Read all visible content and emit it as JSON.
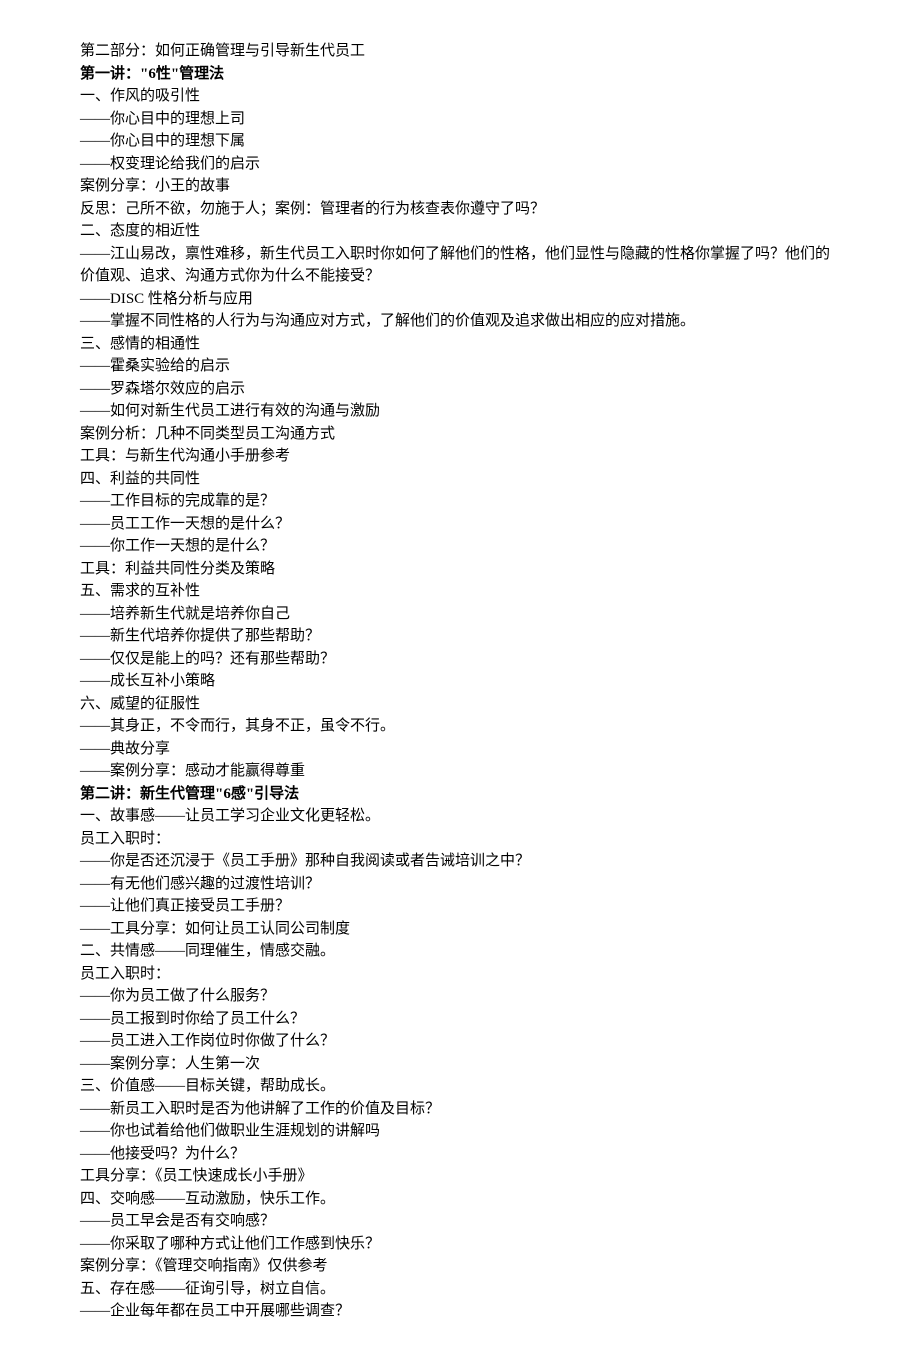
{
  "lines": [
    {
      "text": "第二部分：如何正确管理与引导新生代员工",
      "bold": false
    },
    {
      "text": "第一讲：\"6性\"管理法",
      "bold": true
    },
    {
      "text": "一、作风的吸引性",
      "bold": false
    },
    {
      "text": "——你心目中的理想上司",
      "bold": false
    },
    {
      "text": "——你心目中的理想下属",
      "bold": false
    },
    {
      "text": "——权变理论给我们的启示",
      "bold": false
    },
    {
      "text": "案例分享：小王的故事",
      "bold": false
    },
    {
      "text": "反思：己所不欲，勿施于人；案例：管理者的行为核查表你遵守了吗？",
      "bold": false
    },
    {
      "text": "二、态度的相近性",
      "bold": false
    },
    {
      "text": "——江山易改，禀性难移，新生代员工入职时你如何了解他们的性格，他们显性与隐藏的性格你掌握了吗？他们的价值观、追求、沟通方式你为什么不能接受？",
      "bold": false
    },
    {
      "text": "——DISC 性格分析与应用",
      "bold": false
    },
    {
      "text": "——掌握不同性格的人行为与沟通应对方式，了解他们的价值观及追求做出相应的应对措施。",
      "bold": false
    },
    {
      "text": "三、感情的相通性",
      "bold": false
    },
    {
      "text": "——霍桑实验给的启示",
      "bold": false
    },
    {
      "text": "——罗森塔尔效应的启示",
      "bold": false
    },
    {
      "text": "——如何对新生代员工进行有效的沟通与激励",
      "bold": false
    },
    {
      "text": "案例分析：几种不同类型员工沟通方式",
      "bold": false
    },
    {
      "text": "工具：与新生代沟通小手册参考",
      "bold": false
    },
    {
      "text": "四、利益的共同性",
      "bold": false
    },
    {
      "text": "——工作目标的完成靠的是？",
      "bold": false
    },
    {
      "text": "——员工工作一天想的是什么？",
      "bold": false
    },
    {
      "text": "——你工作一天想的是什么？",
      "bold": false
    },
    {
      "text": "工具：利益共同性分类及策略",
      "bold": false
    },
    {
      "text": "五、需求的互补性",
      "bold": false
    },
    {
      "text": "——培养新生代就是培养你自己",
      "bold": false
    },
    {
      "text": "——新生代培养你提供了那些帮助？",
      "bold": false
    },
    {
      "text": "——仅仅是能上的吗？还有那些帮助？",
      "bold": false
    },
    {
      "text": "——成长互补小策略",
      "bold": false
    },
    {
      "text": "六、威望的征服性",
      "bold": false
    },
    {
      "text": "——其身正，不令而行，其身不正，虽令不行。",
      "bold": false
    },
    {
      "text": "——典故分享",
      "bold": false
    },
    {
      "text": "——案例分享：感动才能赢得尊重",
      "bold": false
    },
    {
      "text": "第二讲：新生代管理\"6感\"引导法",
      "bold": true
    },
    {
      "text": "一、故事感——让员工学习企业文化更轻松。",
      "bold": false
    },
    {
      "text": "员工入职时：",
      "bold": false
    },
    {
      "text": "——你是否还沉浸于《员工手册》那种自我阅读或者告诫培训之中？",
      "bold": false
    },
    {
      "text": "——有无他们感兴趣的过渡性培训？",
      "bold": false
    },
    {
      "text": "——让他们真正接受员工手册？",
      "bold": false
    },
    {
      "text": "——工具分享：如何让员工认同公司制度",
      "bold": false
    },
    {
      "text": "二、共情感——同理催生，情感交融。",
      "bold": false
    },
    {
      "text": "员工入职时：",
      "bold": false
    },
    {
      "text": "——你为员工做了什么服务？",
      "bold": false
    },
    {
      "text": "——员工报到时你给了员工什么？",
      "bold": false
    },
    {
      "text": "——员工进入工作岗位时你做了什么？",
      "bold": false
    },
    {
      "text": "——案例分享：人生第一次",
      "bold": false
    },
    {
      "text": "三、价值感——目标关键，帮助成长。",
      "bold": false
    },
    {
      "text": "——新员工入职时是否为他讲解了工作的价值及目标？",
      "bold": false
    },
    {
      "text": "——你也试着给他们做职业生涯规划的讲解吗",
      "bold": false
    },
    {
      "text": "——他接受吗？为什么？",
      "bold": false
    },
    {
      "text": "工具分享：《员工快速成长小手册》",
      "bold": false
    },
    {
      "text": "四、交响感——互动激励，快乐工作。",
      "bold": false
    },
    {
      "text": "——员工早会是否有交响感？",
      "bold": false
    },
    {
      "text": "——你采取了哪种方式让他们工作感到快乐？",
      "bold": false
    },
    {
      "text": "案例分享：《管理交响指南》仅供参考",
      "bold": false
    },
    {
      "text": "五、存在感——征询引导，树立自信。",
      "bold": false
    },
    {
      "text": "——企业每年都在员工中开展哪些调查？",
      "bold": false
    }
  ]
}
